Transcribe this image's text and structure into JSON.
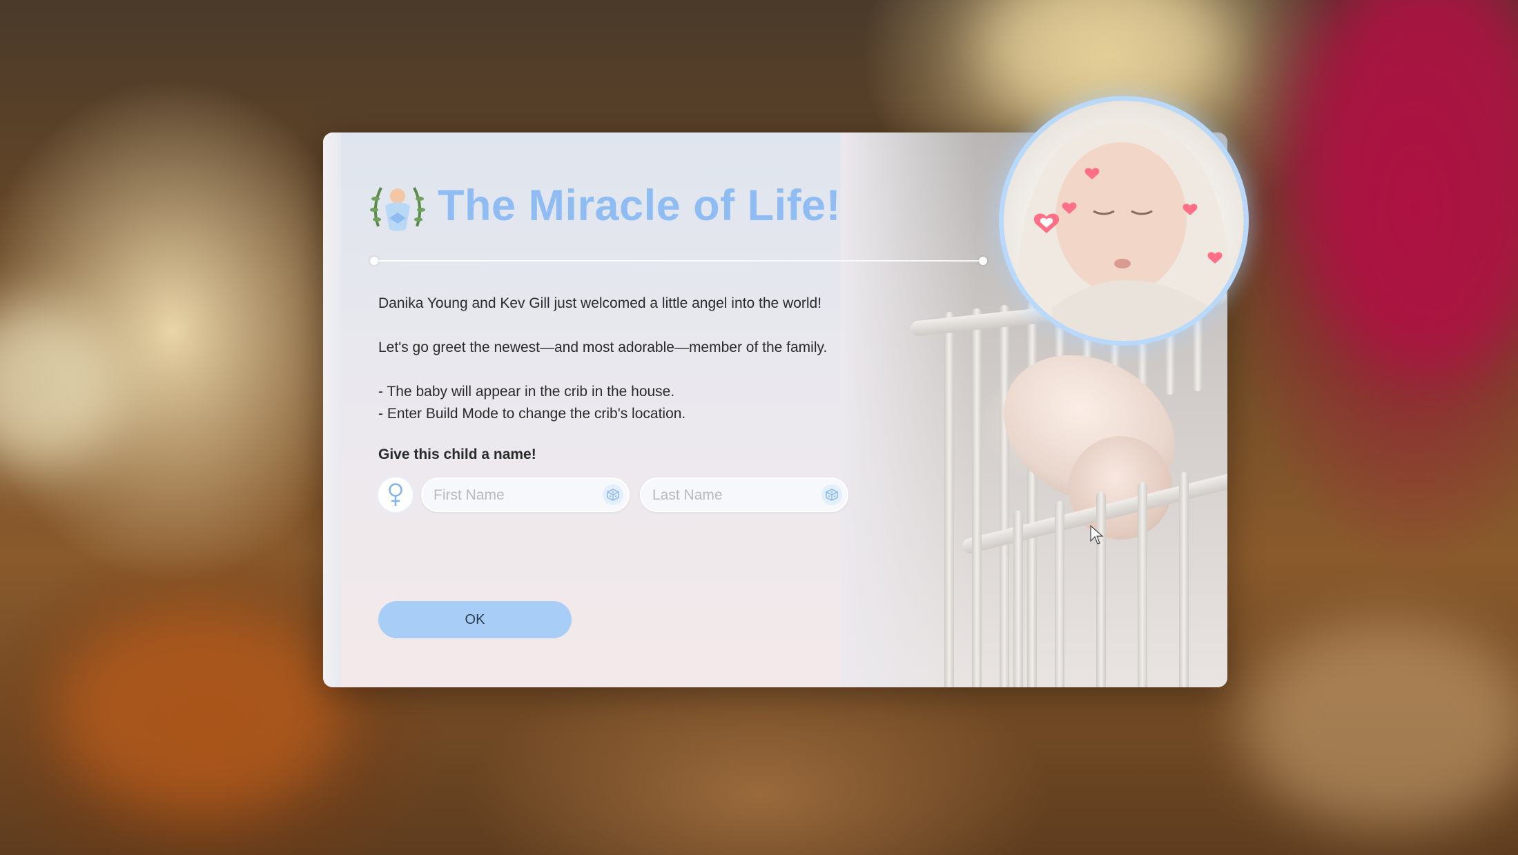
{
  "dialog": {
    "title": "The Miracle of Life!",
    "body": {
      "line1": "Danika Young and Kev Gill just welcomed a little angel into the world!",
      "line2": "Let's go greet the newest—and most adorable—member of the family.",
      "bullet1": " - The baby will appear in the crib in the house.",
      "bullet2": " - Enter Build Mode to change the crib's location."
    },
    "name_prompt": "Give this child a name!",
    "first_name": {
      "value": "",
      "placeholder": "First Name"
    },
    "last_name": {
      "value": "",
      "placeholder": "Last Name"
    },
    "gender_icon": "female-symbol-icon",
    "randomize_icon": "dice-icon",
    "ok_label": "OK"
  },
  "colors": {
    "title": "#8ebcf3",
    "ok_button": "#a8cdf6",
    "portrait_ring": "#b9d9fb"
  }
}
